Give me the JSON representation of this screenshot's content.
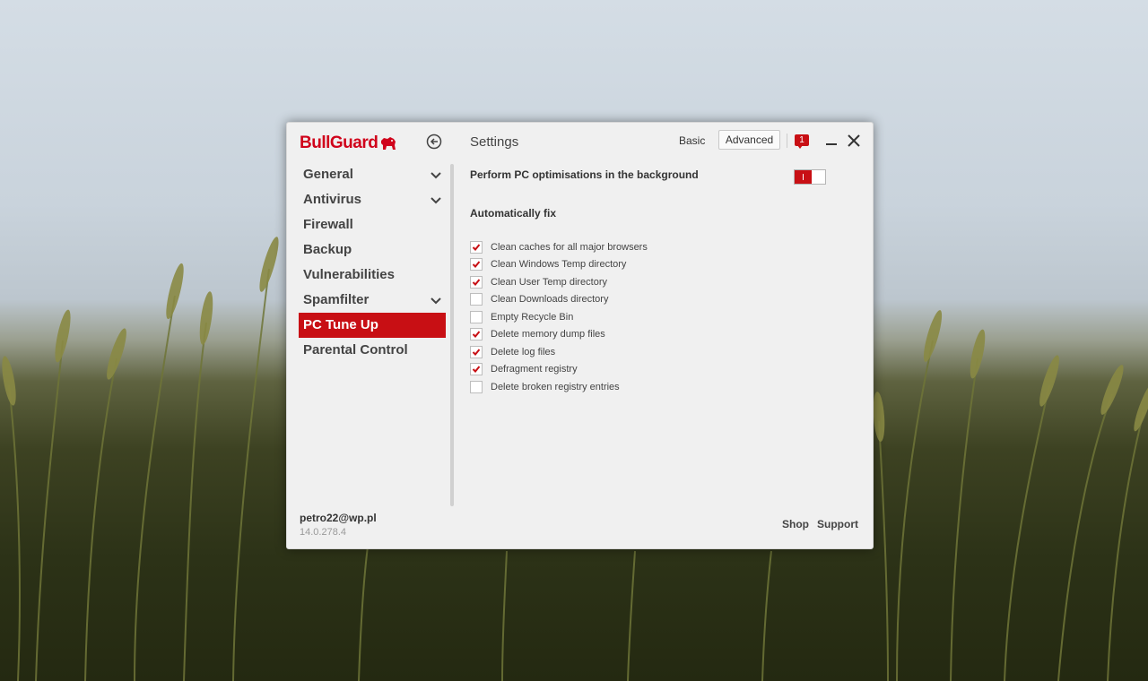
{
  "app": {
    "logo_text": "BullGuard",
    "title": "Settings"
  },
  "header": {
    "basic_label": "Basic",
    "advanced_label": "Advanced",
    "notification_count": "1"
  },
  "sidebar": {
    "items": [
      {
        "label": "General",
        "expandable": true,
        "active": false
      },
      {
        "label": "Antivirus",
        "expandable": true,
        "active": false
      },
      {
        "label": "Firewall",
        "expandable": false,
        "active": false
      },
      {
        "label": "Backup",
        "expandable": false,
        "active": false
      },
      {
        "label": "Vulnerabilities",
        "expandable": false,
        "active": false
      },
      {
        "label": "Spamfilter",
        "expandable": true,
        "active": false
      },
      {
        "label": "PC Tune Up",
        "expandable": false,
        "active": true
      },
      {
        "label": "Parental Control",
        "expandable": false,
        "active": false
      }
    ]
  },
  "content": {
    "background_label": "Perform PC optimisations in the background",
    "background_toggle_on": true,
    "auto_fix_label": "Automatically fix",
    "options": [
      {
        "label": "Clean caches for all major browsers",
        "checked": true
      },
      {
        "label": "Clean Windows Temp directory",
        "checked": true
      },
      {
        "label": "Clean User Temp directory",
        "checked": true
      },
      {
        "label": "Clean Downloads directory",
        "checked": false
      },
      {
        "label": "Empty Recycle Bin",
        "checked": false
      },
      {
        "label": "Delete memory dump files",
        "checked": true
      },
      {
        "label": "Delete log files",
        "checked": true
      },
      {
        "label": "Defragment registry",
        "checked": true
      },
      {
        "label": "Delete broken registry entries",
        "checked": false
      }
    ]
  },
  "footer": {
    "user_email": "petro22@wp.pl",
    "version": "14.0.278.4",
    "shop_label": "Shop",
    "support_label": "Support"
  },
  "colors": {
    "accent": "#c80f14",
    "window_bg": "#f0f0f0",
    "text": "#444444"
  }
}
